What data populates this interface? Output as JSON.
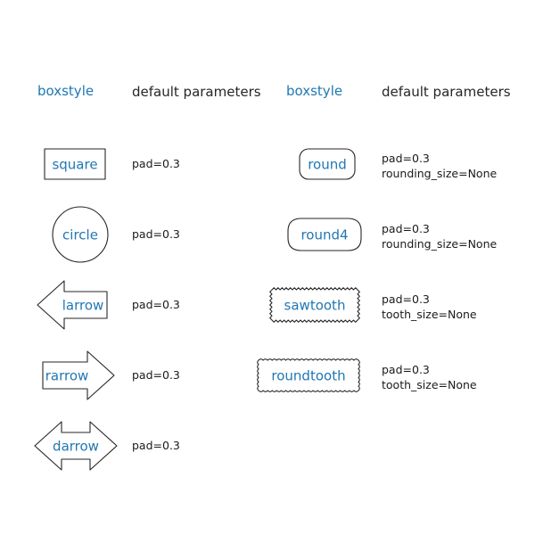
{
  "figure": {
    "title_visible": false,
    "background": "#ffffff",
    "accent_color": "#1f77b4",
    "text_color": "#262626",
    "outline_color": "#262626"
  },
  "columns": [
    {
      "id": "left",
      "header_boxstyle": "boxstyle",
      "header_parameters": "default parameters"
    },
    {
      "id": "right",
      "header_boxstyle": "boxstyle",
      "header_parameters": "default parameters"
    }
  ],
  "entries": {
    "left": [
      {
        "name": "square",
        "shape": "square",
        "params": "pad=0.3"
      },
      {
        "name": "circle",
        "shape": "circle",
        "params": "pad=0.3"
      },
      {
        "name": "larrow",
        "shape": "larrow",
        "params": "pad=0.3"
      },
      {
        "name": "rarrow",
        "shape": "rarrow",
        "params": "pad=0.3"
      },
      {
        "name": "darrow",
        "shape": "darrow",
        "params": "pad=0.3"
      }
    ],
    "right": [
      {
        "name": "round",
        "shape": "round",
        "params": "pad=0.3\nrounding_size=None"
      },
      {
        "name": "round4",
        "shape": "round4",
        "params": "pad=0.3\nrounding_size=None"
      },
      {
        "name": "sawtooth",
        "shape": "sawtooth",
        "params": "pad=0.3\ntooth_size=None"
      },
      {
        "name": "roundtooth",
        "shape": "roundtooth",
        "params": "pad=0.3\ntooth_size=None"
      }
    ]
  }
}
